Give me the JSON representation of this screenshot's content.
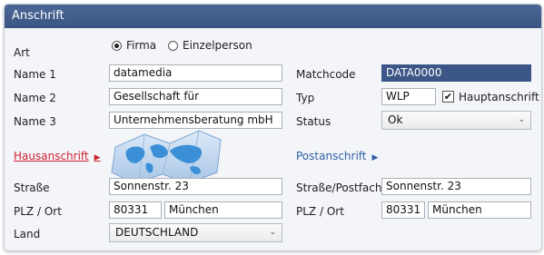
{
  "header": {
    "title": "Anschrift"
  },
  "art": {
    "label": "Art",
    "option_firma": "Firma",
    "option_einzelperson": "Einzelperson",
    "selected": "Firma"
  },
  "name1": {
    "label": "Name 1",
    "value": "datamedia"
  },
  "name2": {
    "label": "Name 2",
    "value": "Gesellschaft für"
  },
  "name3": {
    "label": "Name 3",
    "value": "Unternehmensberatung mbH"
  },
  "matchcode": {
    "label": "Matchcode",
    "value": "DATA0000"
  },
  "typ": {
    "label": "Typ",
    "value": "WLP",
    "haupt_label": "Hauptanschrift",
    "haupt_checked": true,
    "check_glyph": "✔"
  },
  "status": {
    "label": "Status",
    "value": "Ok",
    "arrow": "⌄"
  },
  "hausanschrift": {
    "label": "Hausanschrift",
    "arrow": "▶",
    "color": "#d01f2f"
  },
  "postanschrift": {
    "label": "Postanschrift",
    "arrow": "▶",
    "color": "#2f5fa8"
  },
  "haus": {
    "strasse_label": "Straße",
    "strasse_value": "Sonnenstr. 23",
    "plz_label": "PLZ / Ort",
    "plz_value": "80331",
    "ort_value": "München",
    "land_label": "Land",
    "land_value": "DEUTSCHLAND",
    "land_arrow": "⌄"
  },
  "post": {
    "strasse_label": "Straße/Postfach",
    "strasse_value": "Sonnenstr. 23",
    "plz_label": "PLZ / Ort",
    "plz_value": "80331",
    "ort_value": "München"
  },
  "colors": {
    "header": "#3f5a88",
    "matchcode_bg": "#3c5687",
    "map_blue": "#3b8fd6"
  },
  "icons": {
    "map": "world-map-icon"
  }
}
